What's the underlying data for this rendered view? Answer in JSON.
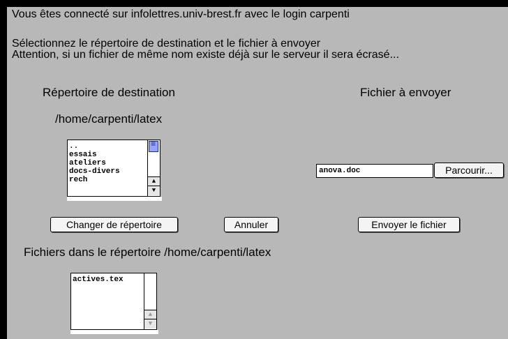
{
  "header": {
    "login_line": "Vous êtes connecté sur infolettres.univ-brest.fr avec le login carpenti",
    "instruction": "Sélectionnez le répertoire de destination et le fichier à envoyer",
    "warning": "Attention, si un fichier de même nom existe déjà sur le serveur il sera écrasé..."
  },
  "destination": {
    "heading": "Répertoire de destination",
    "current_path": "/home/carpenti/latex",
    "directories": [
      "..",
      "essais",
      "ateliers",
      "docs-divers",
      "rech"
    ]
  },
  "upload": {
    "heading": "Fichier à envoyer",
    "file_value": "anova.doc",
    "browse_label": "Parcourir..."
  },
  "actions": {
    "change_dir_label": "Changer de répertoire",
    "cancel_label": "Annuler",
    "send_label": "Envoyer le fichier"
  },
  "files": {
    "heading": "Fichiers dans le répertoire /home/carpenti/latex",
    "items": [
      "actives.tex"
    ]
  },
  "colors": {
    "background": "#b8b8b8",
    "scroll_thumb": "#9aa3ff"
  }
}
